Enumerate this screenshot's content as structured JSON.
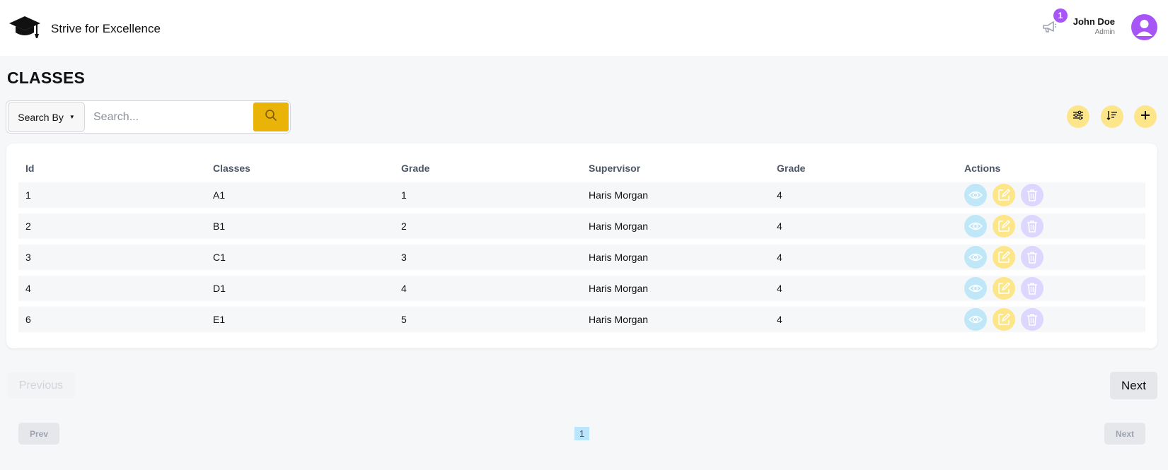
{
  "header": {
    "brand_name": "Strive for Excellence",
    "logo_icon": "graduation-cap-icon",
    "announcement_icon": "megaphone-icon",
    "notification_count": "1",
    "user_name": "John Doe",
    "user_role": "Admin",
    "avatar_icon": "user-avatar-icon"
  },
  "page": {
    "title": "CLASSES"
  },
  "search": {
    "search_by_label": "Search By",
    "placeholder": "Search...",
    "search_icon": "search-icon"
  },
  "toolbar": {
    "filter_icon": "sliders-icon",
    "sort_icon": "sort-icon",
    "add_icon": "plus-icon"
  },
  "table": {
    "columns": [
      "Id",
      "Classes",
      "Grade",
      "Supervisor",
      "Grade",
      "Actions"
    ],
    "rows": [
      [
        "1",
        "A1",
        "1",
        "Haris Morgan",
        "4"
      ],
      [
        "2",
        "B1",
        "2",
        "Haris Morgan",
        "4"
      ],
      [
        "3",
        "C1",
        "3",
        "Haris Morgan",
        "4"
      ],
      [
        "4",
        "D1",
        "4",
        "Haris Morgan",
        "4"
      ],
      [
        "6",
        "E1",
        "5",
        "Haris Morgan",
        "4"
      ]
    ],
    "action_icons": [
      "eye-icon",
      "edit-icon",
      "trash-icon"
    ]
  },
  "pagination": {
    "previous_label": "Previous",
    "next_label": "Next",
    "prev_short": "Prev",
    "next_short": "Next",
    "current_page": "1"
  },
  "colors": {
    "accent": "#eab308",
    "accent_light": "#fde68a",
    "purple": "#a855f7",
    "view_bg": "#bfe7f7",
    "delete_bg": "#ddd6fe"
  }
}
